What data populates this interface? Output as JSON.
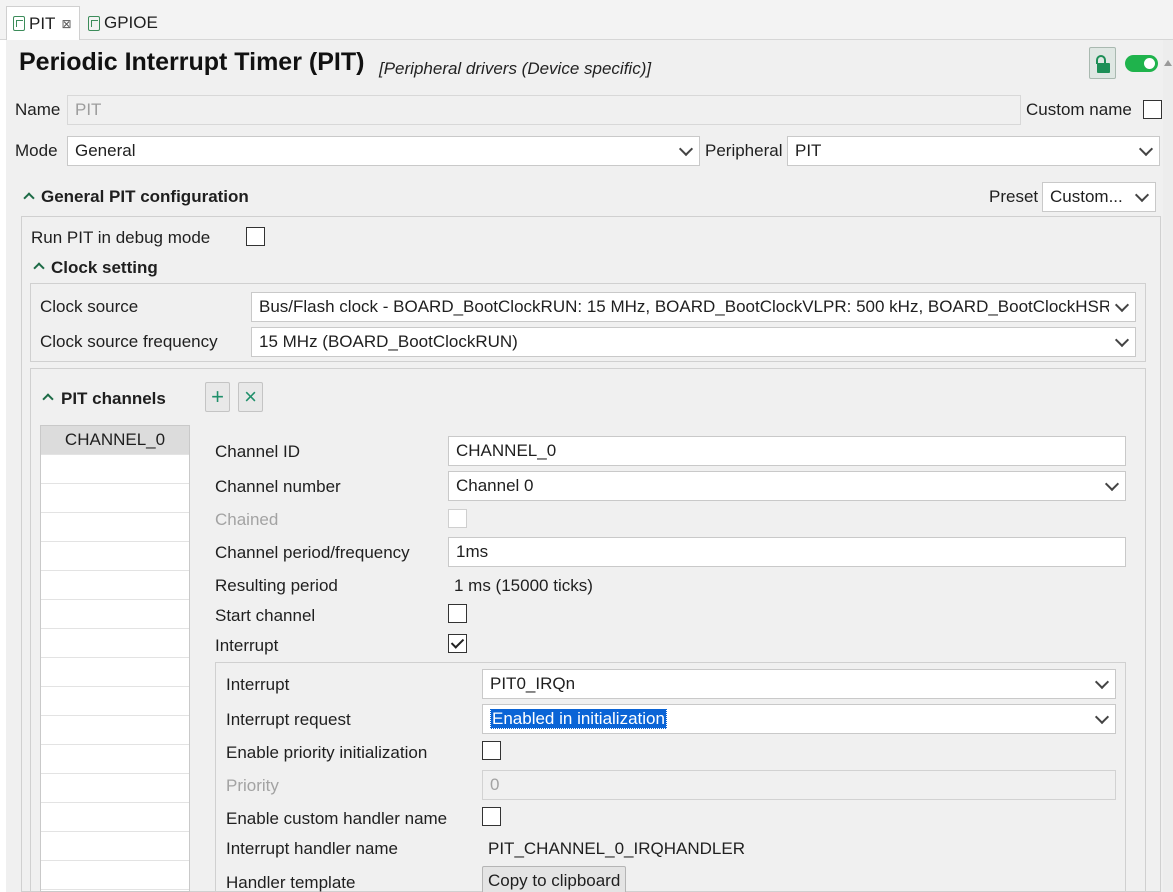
{
  "tabs": [
    {
      "label": "PIT",
      "icon": "peripheral-icon",
      "close": "⊠"
    },
    {
      "label": "GPIOE",
      "icon": "peripheral-icon"
    }
  ],
  "header": {
    "title": "Periodic Interrupt Timer (PIT)",
    "subtitle": "[Peripheral drivers (Device specific)]",
    "enabled": true
  },
  "name_row": {
    "label": "Name",
    "value": "PIT",
    "custom_label": "Custom name",
    "custom_checked": false
  },
  "mode_row": {
    "label": "Mode",
    "value": "General",
    "peripheral_label": "Peripheral",
    "peripheral_value": "PIT"
  },
  "general_section": {
    "title": "General PIT configuration",
    "preset_label": "Preset",
    "preset_value": "Custom...",
    "debug_label": "Run PIT in debug mode",
    "debug_checked": false
  },
  "clock_section": {
    "title": "Clock setting",
    "source_label": "Clock source",
    "source_value": "Bus/Flash clock - BOARD_BootClockRUN: 15 MHz, BOARD_BootClockVLPR: 500 kHz, BOARD_BootClockHSRUN",
    "freq_label": "Clock source frequency",
    "freq_value": "15 MHz (BOARD_BootClockRUN)"
  },
  "channels_section": {
    "title": "PIT channels",
    "add_symbol": "+",
    "remove_symbol": "×",
    "channels": [
      "CHANNEL_0"
    ]
  },
  "channel": {
    "id_label": "Channel ID",
    "id_value": "CHANNEL_0",
    "number_label": "Channel number",
    "number_value": "Channel 0",
    "chained_label": "Chained",
    "period_label": "Channel period/frequency",
    "period_value": "1ms",
    "resulting_label": "Resulting period",
    "resulting_value": "1 ms (15000 ticks)",
    "start_label": "Start channel",
    "start_checked": false,
    "interrupt_label": "Interrupt",
    "interrupt_checked": true
  },
  "interrupt": {
    "irq_label": "Interrupt",
    "irq_value": "PIT0_IRQn",
    "request_label": "Interrupt request",
    "request_value": "Enabled in initialization",
    "prio_init_label": "Enable priority initialization",
    "priority_label": "Priority",
    "priority_value": "0",
    "custom_handler_label": "Enable custom handler name",
    "handler_name_label": "Interrupt handler name",
    "handler_name_value": "PIT_CHANNEL_0_IRQHANDLER",
    "template_label": "Handler template",
    "copy_button": "Copy to clipboard"
  },
  "colors": {
    "accent": "#1fb34c",
    "selection": "#0a64d6"
  }
}
